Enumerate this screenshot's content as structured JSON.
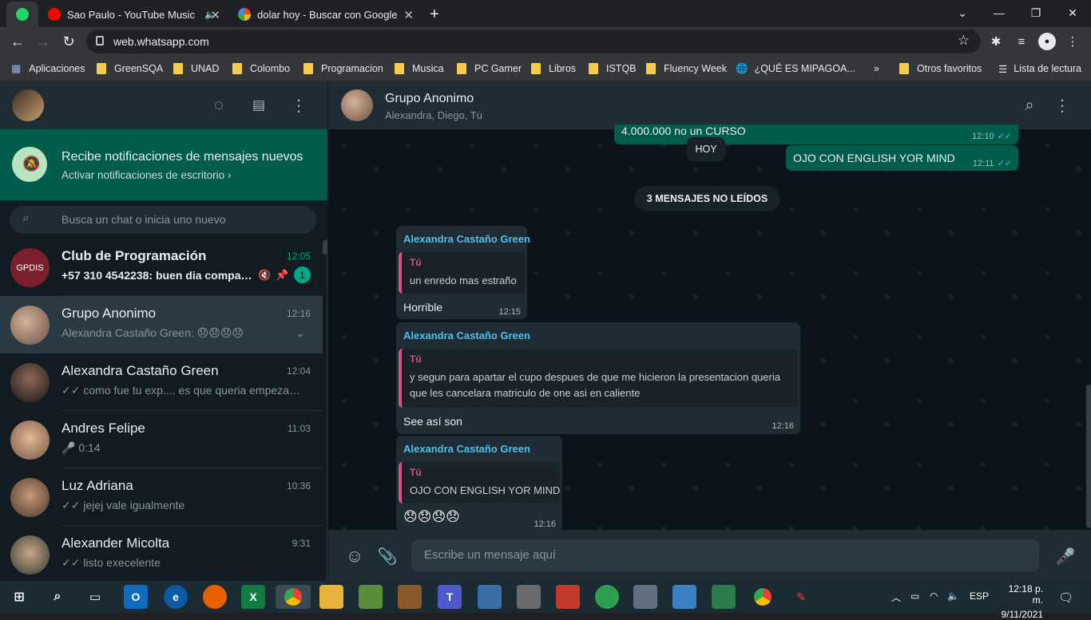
{
  "browser": {
    "tabs": [
      {
        "label": "Sao Paulo - YouTube Music",
        "active": false
      },
      {
        "label": "dolar hoy - Buscar con Google",
        "active": false
      }
    ],
    "url": "web.whatsapp.com",
    "bookmarks": [
      "Aplicaciones",
      "GreenSQA",
      "UNAD",
      "Colombo",
      "Programacion",
      "Musica",
      "PC Gamer",
      "Libros",
      "ISTQB",
      "Fluency Week",
      "¿QUÉ ES MIPAGOA...",
      "»",
      "Otros favoritos",
      "Lista de lectura"
    ]
  },
  "sidebar": {
    "notification": {
      "title": "Recibe notificaciones de mensajes nuevos",
      "link": "Activar notificaciones de escritorio ›"
    },
    "search_placeholder": "Busca un chat o inicia uno nuevo",
    "chats": [
      {
        "name": "Club de Programación",
        "time": "12:05",
        "preview": "+57 310 4542238: buen dia compañ...",
        "unread": "1",
        "avatar_text": "GPDIS",
        "avatar_color": "#7a1f2b",
        "bold": true
      },
      {
        "name": "Grupo Anonimo",
        "time": "12:16",
        "preview": "Alexandra Castaño Green: 😞😞😞😞",
        "avatar_color": "#8a6a5a",
        "selected": true
      },
      {
        "name": "Alexandra Castaño Green",
        "time": "12:04",
        "preview": "✓✓ como fue tu exp.... es que queria empezar c...",
        "avatar_color": "#3b2a2a"
      },
      {
        "name": "Andres Felipe",
        "time": "11:03",
        "preview": "🎤 0:14",
        "avatar_color": "#c9a48a"
      },
      {
        "name": "Luz Adriana",
        "time": "10:36",
        "preview": "✓✓ jejej vale igualmente",
        "avatar_color": "#9a6b4f"
      },
      {
        "name": "Alexander Micolta",
        "time": "9:31",
        "preview": "✓✓ listo execelente",
        "avatar_color": "#3a4a3c"
      }
    ]
  },
  "conversation": {
    "title": "Grupo Anonimo",
    "members": "Alexandra, Diego, Tú",
    "top_out_partial": {
      "text": "4.000.000 no un CURSO",
      "time": "12:10"
    },
    "date_pill": "HOY",
    "out_msg": {
      "text": "OJO CON ENGLISH YOR MIND",
      "time": "12:11"
    },
    "unread_pill": "3 MENSAJES NO LEÍDOS",
    "messages": [
      {
        "sender": "Alexandra Castaño Green",
        "quote_author": "Tú",
        "quote": "un enredo mas estraño",
        "body": "Horrible",
        "time": "12:15"
      },
      {
        "sender": "Alexandra Castaño Green",
        "quote_author": "Tú",
        "quote": "y segun para apartar el cupo despues de que me hicieron la presentacion queria\nque les cancelara matriculo de one asi en caliente",
        "body": "See así son",
        "time": "12:16"
      },
      {
        "sender": "Alexandra Castaño Green",
        "quote_author": "Tú",
        "quote": "OJO CON ENGLISH YOR MIND",
        "body": "😞😞😞😞",
        "time": "12:16"
      }
    ],
    "composer_placeholder": "Escribe un mensaje aquí"
  },
  "taskbar": {
    "lang": "ESP",
    "time": "12:18 p. m.",
    "date": "9/11/2021"
  },
  "colors": {
    "whatsapp_green": "#005c4b",
    "panel": "#202c33",
    "bg": "#111b21",
    "link_blue": "#53bdeb",
    "quote_pink": "#d6528b"
  }
}
